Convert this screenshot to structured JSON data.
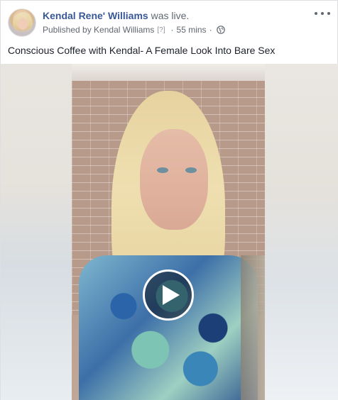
{
  "post": {
    "author_name": "Kendal Rene' Williams",
    "status_text": "was live.",
    "published_by": "Published by Kendal Williams",
    "help_marker": "[?]",
    "separator": "·",
    "time_ago": "55 mins",
    "audience_icon": "globe-icon",
    "more_icon": "more-options-icon",
    "text": "Conscious Coffee with Kendal- A Female Look Into Bare Sex"
  },
  "video": {
    "play_icon": "play-icon"
  },
  "colors": {
    "author_link": "#385898",
    "meta_text": "#606770",
    "body_text": "#1d2129"
  }
}
